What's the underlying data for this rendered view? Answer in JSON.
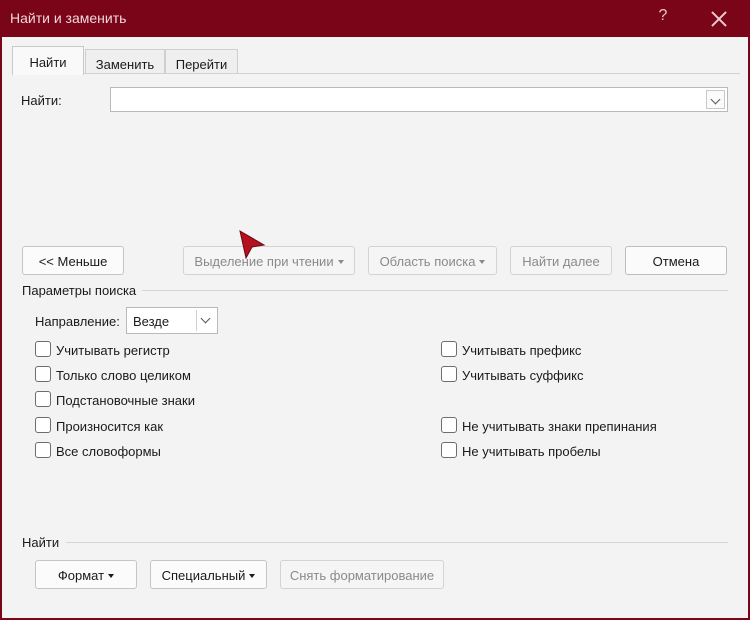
{
  "window": {
    "title": "Найти и заменить",
    "help_label": "?",
    "close_icon": "close-icon"
  },
  "tabs": [
    {
      "label": "Найти",
      "active": true
    },
    {
      "label": "Заменить",
      "active": false
    },
    {
      "label": "Перейти",
      "active": false
    }
  ],
  "find": {
    "label": "Найти:",
    "value": ""
  },
  "buttons": {
    "less": "<< Меньше",
    "reading_highlight": "Выделение при чтении",
    "search_scope": "Область поиска",
    "find_next": "Найти далее",
    "cancel": "Отмена"
  },
  "options": {
    "section_title": "Параметры поиска",
    "direction_label": "Направление:",
    "direction_value": "Везде",
    "checkboxes_left": [
      {
        "label": "Учитывать регистр",
        "checked": false
      },
      {
        "label": "Только слово целиком",
        "checked": false
      },
      {
        "label": "Подстановочные знаки",
        "checked": false
      },
      {
        "label": "Произносится как",
        "checked": false
      },
      {
        "label": "Все словоформы",
        "checked": false
      }
    ],
    "checkboxes_right": [
      {
        "label": "Учитывать префикс",
        "checked": false
      },
      {
        "label": "Учитывать суффикс",
        "checked": false
      },
      {
        "label": "Не учитывать знаки препинания",
        "checked": false
      },
      {
        "label": "Не учитывать пробелы",
        "checked": false
      }
    ]
  },
  "footer": {
    "section_title": "Найти",
    "format": "Формат",
    "special": "Специальный",
    "clear_formatting": "Снять форматирование"
  },
  "colors": {
    "titlebar": "#7a0418",
    "pointer": "#b5101e"
  }
}
